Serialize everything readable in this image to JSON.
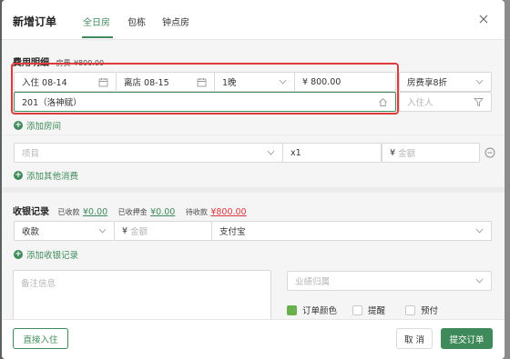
{
  "header": {
    "title": "新增订单",
    "tabs": [
      {
        "label": "全日房",
        "active": true
      },
      {
        "label": "包栋",
        "active": false
      },
      {
        "label": "钟点房",
        "active": false
      }
    ]
  },
  "fee_section": {
    "title": "费用明细",
    "room_fee_label": "房费",
    "room_fee_value": "¥800.00",
    "checkin": "入住 08-14",
    "checkout": "离店 08-15",
    "nights": "1晚",
    "price": "¥ 800.00",
    "discount": "房费享8折",
    "room": "201（洛神赋）",
    "guest_placeholder": "入住人",
    "add_room": "添加房间"
  },
  "other_fees": {
    "item_placeholder": "项目",
    "qty": "x1",
    "amount_prefix": "¥",
    "amount_placeholder": "金额",
    "add_other": "添加其他消费"
  },
  "cashier": {
    "title": "收银记录",
    "received_label": "已收款",
    "received_value": "¥0.00",
    "deposit_label": "已收押金",
    "deposit_value": "¥0.00",
    "pending_label": "待收款",
    "pending_value": "¥800.00",
    "type": "收款",
    "amount_prefix": "¥",
    "amount_placeholder": "金额",
    "method": "支付宝",
    "add_record": "添加收银记录"
  },
  "extra": {
    "note_placeholder": "备注信息",
    "performance_placeholder": "业绩归属",
    "order_color": "订单颜色",
    "remind": "提醒",
    "prepay": "预付"
  },
  "footer": {
    "direct_checkin": "直接入住",
    "cancel": "取 消",
    "submit": "提交订单"
  },
  "colors": {
    "accent": "#3f8a5a",
    "highlight": "#e0393a",
    "pending": "#d9363e",
    "order_color_swatch": "#6ab04c"
  }
}
